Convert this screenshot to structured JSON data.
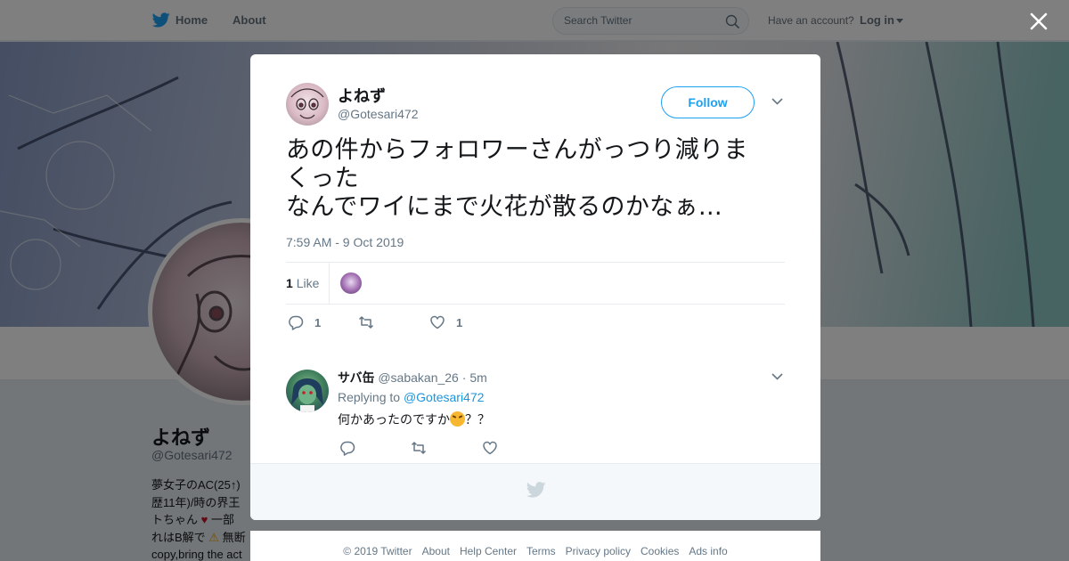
{
  "nav": {
    "home_label": "Home",
    "about_label": "About",
    "search_placeholder": "Search Twitter",
    "account_question": "Have an account?",
    "login_label": "Log in"
  },
  "profile": {
    "name": "よねず",
    "handle": "@Gotesari472",
    "bio_lines": [
      "夢女子のAC(25↑)",
      "歴11年)/時の界王",
      "トちゃん",
      "一部",
      "れはB解で",
      "無断",
      "copy,bring the act"
    ]
  },
  "tweet": {
    "author_name": "よねず",
    "author_handle": "@Gotesari472",
    "follow_label": "Follow",
    "text_lines": [
      "あの件からフォロワーさんがっつり減りま",
      "くった",
      "なんでワイにまで火花が散るのかなぁ…"
    ],
    "timestamp": "7:59 AM - 9 Oct 2019",
    "likes_count": "1",
    "likes_label": "Like",
    "reply_count": "1",
    "retweet_count": "",
    "like_action_count": "1"
  },
  "reply": {
    "author_name": "サバ缶",
    "author_handle": "@sabakan_26",
    "separator": "·",
    "age": "5m",
    "replying_to_label": "Replying to",
    "replying_to_handle": "@Gotesari472",
    "text_before_emoji": "何かあったのですか",
    "text_after_emoji": "？？"
  },
  "footer": {
    "links": [
      "© 2019 Twitter",
      "About",
      "Help Center",
      "Terms",
      "Privacy policy",
      "Cookies",
      "Ads info"
    ]
  },
  "colors": {
    "twitter_blue": "#1da1f2",
    "link_blue": "#1b95e0",
    "secondary_text": "#657786",
    "primary_text": "#14171a",
    "overlay": "rgba(0,0,0,0.5)"
  },
  "icons": [
    "twitter-bird-icon",
    "search-icon",
    "caret-down-icon",
    "close-icon",
    "chevron-down-icon",
    "reply-icon",
    "retweet-icon",
    "heart-icon"
  ]
}
